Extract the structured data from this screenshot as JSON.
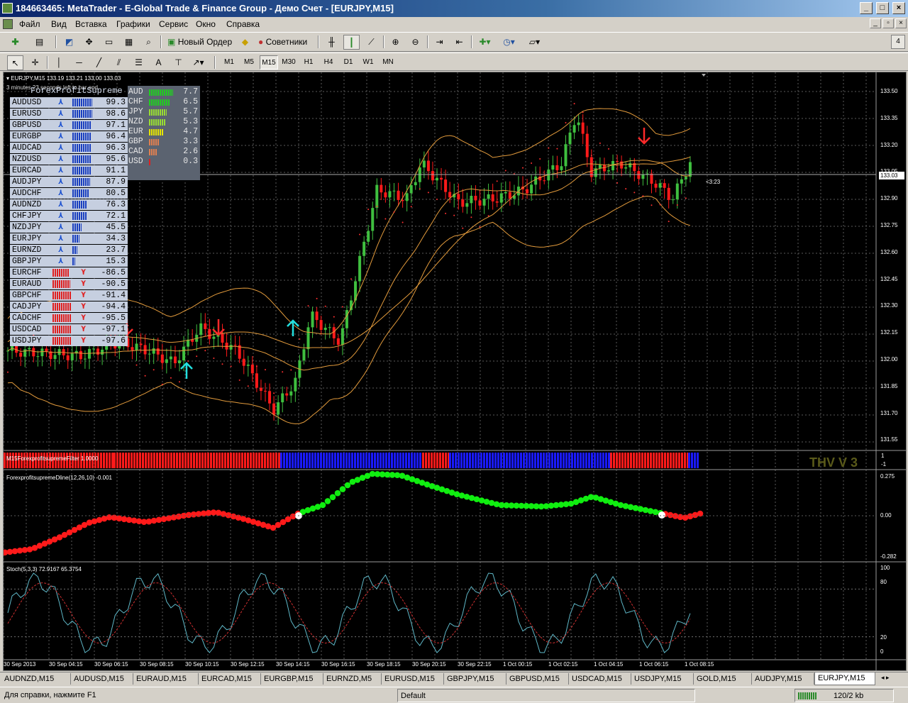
{
  "window": {
    "title": "184663465: MetaTrader - E-Global Trade & Finance Group - Демо Счет - [EURJPY,M15]"
  },
  "menu": [
    "Файл",
    "Вид",
    "Вставка",
    "Графики",
    "Сервис",
    "Окно",
    "Справка"
  ],
  "toolbar": {
    "new_order": "Новый Ордер",
    "advisors": "Советники",
    "profile_count": "4"
  },
  "timeframes": [
    "M1",
    "M5",
    "M15",
    "M30",
    "H1",
    "H4",
    "D1",
    "W1",
    "MN"
  ],
  "active_timeframe": "M15",
  "chart": {
    "header": "EURJPY,M15  133.19 133.21 133.00 133.03",
    "timer": "3 minutes 23 seconds left to bar end",
    "current_price": "133.03",
    "countdown": "<3:23",
    "price_axis": [
      "133.50",
      "133.35",
      "133.20",
      "133.05",
      "132.90",
      "132.75",
      "132.60",
      "132.45",
      "132.30",
      "132.15",
      "132.00",
      "131.85",
      "131.70",
      "131.55"
    ],
    "time_axis": [
      "30 Sep 2013",
      "30 Sep 04:15",
      "30 Sep 06:15",
      "30 Sep 08:15",
      "30 Sep 10:15",
      "30 Sep 12:15",
      "30 Sep 14:15",
      "30 Sep 16:15",
      "30 Sep 18:15",
      "30 Sep 20:15",
      "30 Sep 22:15",
      "1 Oct 00:15",
      "1 Oct 02:15",
      "1 Oct 04:15",
      "1 Oct 06:15",
      "1 Oct 08:15"
    ]
  },
  "meter": {
    "title": "ForexProfitSupreme Meter",
    "pairs": [
      {
        "name": "AUDUSD",
        "value": "99.3",
        "dir": "up"
      },
      {
        "name": "EURUSD",
        "value": "98.6",
        "dir": "up"
      },
      {
        "name": "GBPUSD",
        "value": "97.1",
        "dir": "up"
      },
      {
        "name": "EURGBP",
        "value": "96.4",
        "dir": "up"
      },
      {
        "name": "AUDCAD",
        "value": "96.3",
        "dir": "up"
      },
      {
        "name": "NZDUSD",
        "value": "95.6",
        "dir": "up"
      },
      {
        "name": "EURCAD",
        "value": "91.1",
        "dir": "up"
      },
      {
        "name": "AUDJPY",
        "value": "87.9",
        "dir": "up"
      },
      {
        "name": "AUDCHF",
        "value": "80.5",
        "dir": "up"
      },
      {
        "name": "AUDNZD",
        "value": "76.3",
        "dir": "up"
      },
      {
        "name": "CHFJPY",
        "value": "72.1",
        "dir": "up"
      },
      {
        "name": "NZDJPY",
        "value": "45.5",
        "dir": "up"
      },
      {
        "name": "EURJPY",
        "value": "34.3",
        "dir": "up"
      },
      {
        "name": "EURNZD",
        "value": "23.7",
        "dir": "up"
      },
      {
        "name": "GBPJPY",
        "value": "15.3",
        "dir": "up"
      },
      {
        "name": "EURCHF",
        "value": "-86.5",
        "dir": "down"
      },
      {
        "name": "EURAUD",
        "value": "-90.5",
        "dir": "down"
      },
      {
        "name": "GBPCHF",
        "value": "-91.4",
        "dir": "down"
      },
      {
        "name": "CADJPY",
        "value": "-94.4",
        "dir": "down"
      },
      {
        "name": "CADCHF",
        "value": "-95.5",
        "dir": "down"
      },
      {
        "name": "USDCAD",
        "value": "-97.1",
        "dir": "down"
      },
      {
        "name": "USDJPY",
        "value": "-97.6",
        "dir": "down"
      }
    ],
    "currencies": [
      {
        "name": "AUD",
        "value": "7.7",
        "color": "#22cc22"
      },
      {
        "name": "CHF",
        "value": "6.5",
        "color": "#22cc22"
      },
      {
        "name": "JPY",
        "value": "5.7",
        "color": "#99dd33"
      },
      {
        "name": "NZD",
        "value": "5.3",
        "color": "#99dd33"
      },
      {
        "name": "EUR",
        "value": "4.7",
        "color": "#e6e600"
      },
      {
        "name": "GBP",
        "value": "3.3",
        "color": "#e08050"
      },
      {
        "name": "CAD",
        "value": "2.6",
        "color": "#e08050"
      },
      {
        "name": "USD",
        "value": "0.3",
        "color": "#e02020"
      }
    ]
  },
  "filter": {
    "label": "M15ForexprofitsupremeFilter 1.0000",
    "badge": "THV V 3",
    "axis_top": "1",
    "axis_bottom": "-1"
  },
  "dline": {
    "label": "ForexprofitsupremeDline(12,26,10) -0.001",
    "axis": [
      "0.275",
      "0.00",
      "-0.282"
    ]
  },
  "stoch": {
    "label": "Stoch(5,3,3) 72.9167 65.3754",
    "axis": [
      "100",
      "80",
      "20",
      "0"
    ]
  },
  "tabs": [
    "AUDNZD,M15",
    "AUDUSD,M15",
    "EURAUD,M15",
    "EURCAD,M15",
    "EURGBP,M15",
    "EURNZD,M5",
    "EURUSD,M15",
    "GBPJPY,M15",
    "GBPUSD,M15",
    "USDCAD,M15",
    "USDJPY,M15",
    "GOLD,M15",
    "AUDJPY,M15",
    "EURJPY,M15"
  ],
  "active_tab": "EURJPY,M15",
  "status": {
    "help": "Для справки, нажмите F1",
    "profile": "Default",
    "traffic": "120/2 kb"
  }
}
